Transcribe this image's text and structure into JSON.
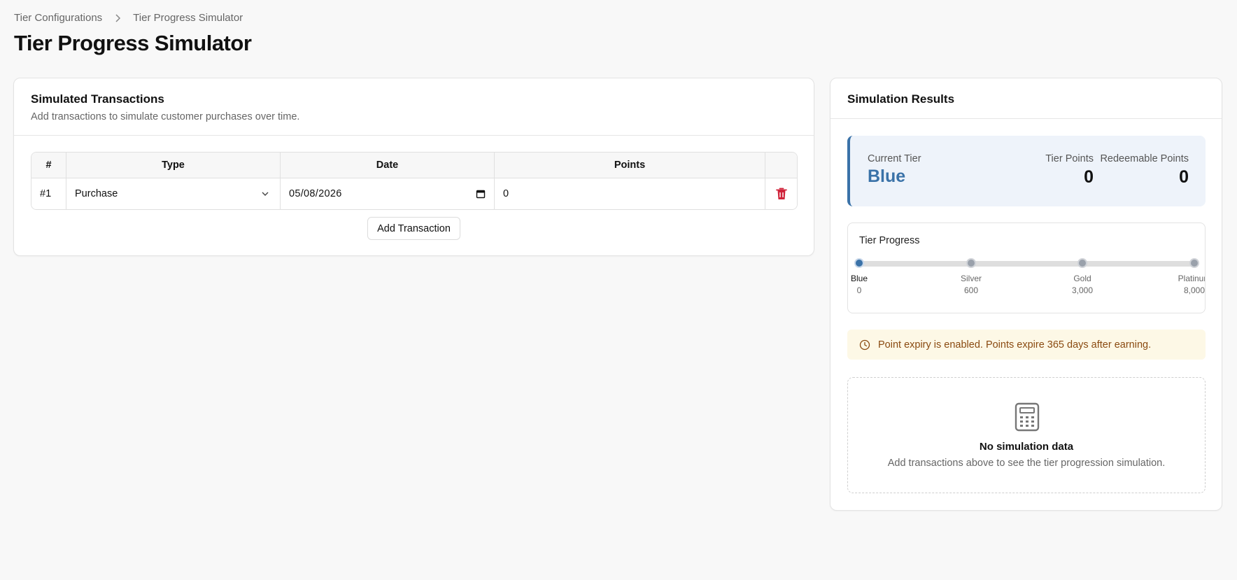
{
  "breadcrumb": {
    "items": [
      "Tier Configurations",
      "Tier Progress Simulator"
    ]
  },
  "page": {
    "title": "Tier Progress Simulator"
  },
  "transactions": {
    "title": "Simulated Transactions",
    "description": "Add transactions to simulate customer purchases over time.",
    "columns": [
      "#",
      "Type",
      "Date",
      "Points",
      ""
    ],
    "rows": [
      {
        "index": "#1",
        "type": "Purchase",
        "date": "05/08/2026",
        "points": "0"
      }
    ],
    "add_button": "Add Transaction"
  },
  "results": {
    "title": "Simulation Results",
    "current_tier_label": "Current Tier",
    "current_tier": "Blue",
    "tier_points_label": "Tier Points",
    "tier_points": "0",
    "redeemable_label": "Redeemable Points",
    "redeemable_points": "0",
    "progress": {
      "title": "Tier Progress",
      "current_progress": 0,
      "tiers": [
        {
          "name": "Blue",
          "threshold": "0"
        },
        {
          "name": "Silver",
          "threshold": "600"
        },
        {
          "name": "Gold",
          "threshold": "3,000"
        },
        {
          "name": "Platinum",
          "threshold": "8,000"
        }
      ]
    },
    "notice": "Point expiry is enabled. Points expire 365 days after earning.",
    "empty": {
      "title": "No simulation data",
      "description": "Add transactions above to see the tier progression simulation."
    }
  },
  "colors": {
    "accent": "#3a72a8",
    "danger": "#d0233a",
    "notice_bg": "#fdf8e6",
    "notice_text": "#8a4a10"
  }
}
